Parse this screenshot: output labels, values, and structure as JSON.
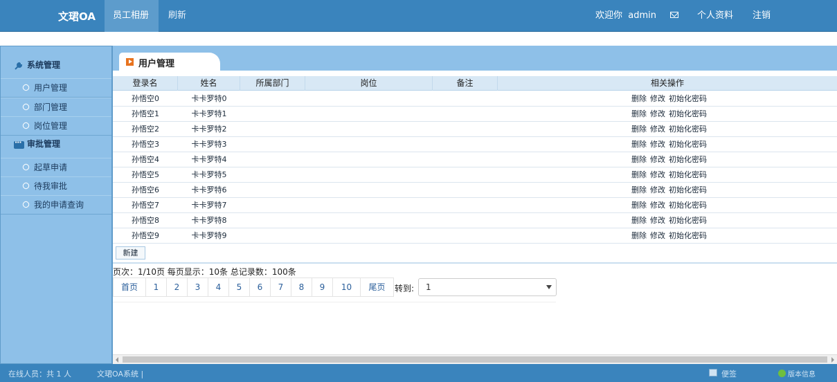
{
  "header": {
    "brand": "文珺OA",
    "tabs": [
      {
        "label": "员工相册",
        "active": true
      },
      {
        "label": "刷新",
        "active": false
      }
    ],
    "welcome": "欢迎你",
    "username": "admin",
    "profile": "个人资料",
    "logout": "注销"
  },
  "sidebar": {
    "groups": [
      {
        "label": "系统管理",
        "items": [
          "用户管理",
          "部门管理",
          "岗位管理"
        ]
      },
      {
        "label": "审批管理",
        "items": [
          "起草申请",
          "待我审批",
          "我的申请查询"
        ]
      }
    ]
  },
  "content": {
    "tab_label": "用户管理",
    "columns": [
      "登录名",
      "姓名",
      "所属部门",
      "岗位",
      "备注",
      "相关操作"
    ],
    "rows": [
      {
        "login": "孙悟空0",
        "name": "卡卡罗特0"
      },
      {
        "login": "孙悟空1",
        "name": "卡卡罗特1"
      },
      {
        "login": "孙悟空2",
        "name": "卡卡罗特2"
      },
      {
        "login": "孙悟空3",
        "name": "卡卡罗特3"
      },
      {
        "login": "孙悟空4",
        "name": "卡卡罗特4"
      },
      {
        "login": "孙悟空5",
        "name": "卡卡罗特5"
      },
      {
        "login": "孙悟空6",
        "name": "卡卡罗特6"
      },
      {
        "login": "孙悟空7",
        "name": "卡卡罗特7"
      },
      {
        "login": "孙悟空8",
        "name": "卡卡罗特8"
      },
      {
        "login": "孙悟空9",
        "name": "卡卡罗特9"
      }
    ],
    "ops": [
      "删除",
      "修改",
      "初始化密码"
    ],
    "new_button": "新建"
  },
  "pagination": {
    "info": "页次：1/10页   每页显示：10条   总记录数：100条",
    "first": "首页",
    "pages": [
      "1",
      "2",
      "3",
      "4",
      "5",
      "6",
      "7",
      "8",
      "9",
      "10"
    ],
    "last": "尾页",
    "goto_label": "转到:",
    "goto_value": "1"
  },
  "footer": {
    "online": "在线人员：共 1 人",
    "system": "文珺OA系统 |",
    "notes": "便签",
    "version": "版本信息"
  },
  "colors": {
    "primary": "#3a84bd",
    "sidebar": "#8ec0e8",
    "accent": "#e8731e"
  }
}
